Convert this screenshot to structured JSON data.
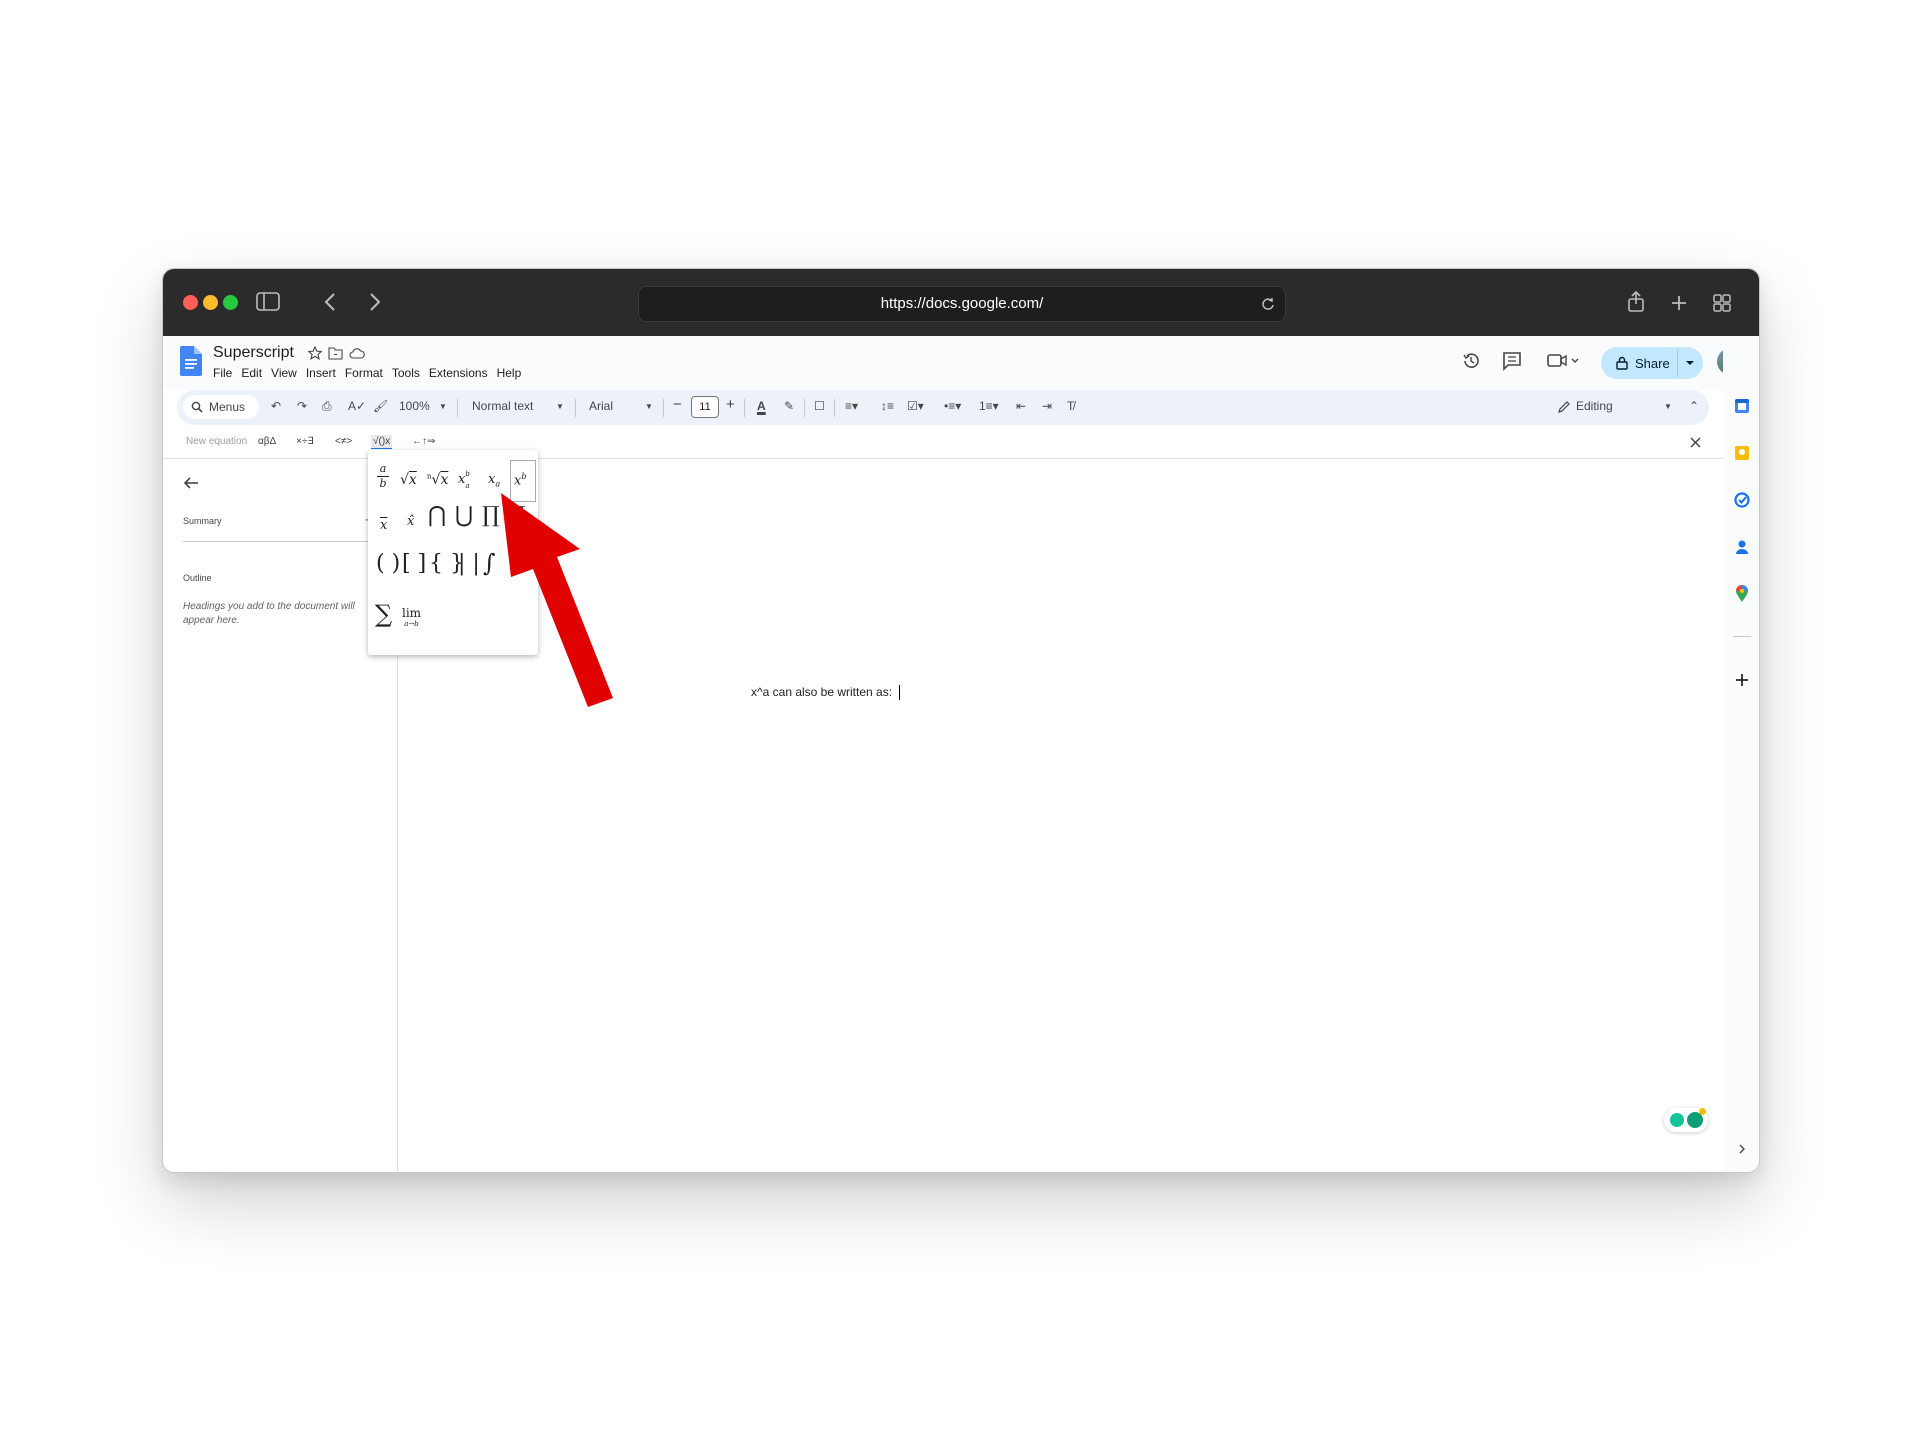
{
  "browser": {
    "url": "https://docs.google.com/"
  },
  "document": {
    "title": "Superscript",
    "menu": [
      "File",
      "Edit",
      "View",
      "Insert",
      "Format",
      "Tools",
      "Extensions",
      "Help"
    ],
    "share_label": "Share",
    "body_text": "x^a can also be written as: "
  },
  "toolbar": {
    "search_menus": "Menus",
    "zoom": "100%",
    "style": "Normal text",
    "font": "Arial",
    "font_size": "11",
    "mode": "Editing"
  },
  "equation_bar": {
    "new_equation": "New equation",
    "groups": [
      "αβΔ",
      "×÷∃",
      "<≠>",
      "√()x",
      "←↑⇒"
    ]
  },
  "outline_panel": {
    "summary_label": "Summary",
    "outline_label": "Outline",
    "placeholder": "Headings you add to the document will appear here."
  },
  "math_popup": {
    "row1": [
      "a/b",
      "√x",
      "ⁿ√x",
      "x_a^b",
      "x_a",
      "x^b"
    ],
    "row2": [
      "x̄",
      "x̂",
      "⋂",
      "⋃",
      "∏",
      "∐"
    ],
    "row3": [
      "( )",
      "[ ]",
      "{ }",
      "| |",
      "∫",
      "∮"
    ],
    "row4": [
      "∑",
      "lim"
    ],
    "selected": "x^b",
    "limit_sub": "a→b"
  },
  "colors": {
    "accent_arrow": "#e00000",
    "share_bg": "#c2e7ff",
    "toolbar_bg": "#edf2fa",
    "titlebar": "#2b2b2b"
  },
  "icons": [
    "sidebar-icon",
    "back-icon",
    "forward-icon",
    "reload-icon",
    "share-icon",
    "new-tab-icon",
    "tab-overview-icon",
    "docs-logo-icon",
    "star-icon",
    "move-icon",
    "cloud-icon",
    "history-icon",
    "comment-icon",
    "meet-icon",
    "lock-icon",
    "calendar-icon",
    "keep-icon",
    "tasks-icon",
    "contacts-icon",
    "maps-icon",
    "plus-icon",
    "close-icon",
    "arrow-back-icon"
  ]
}
